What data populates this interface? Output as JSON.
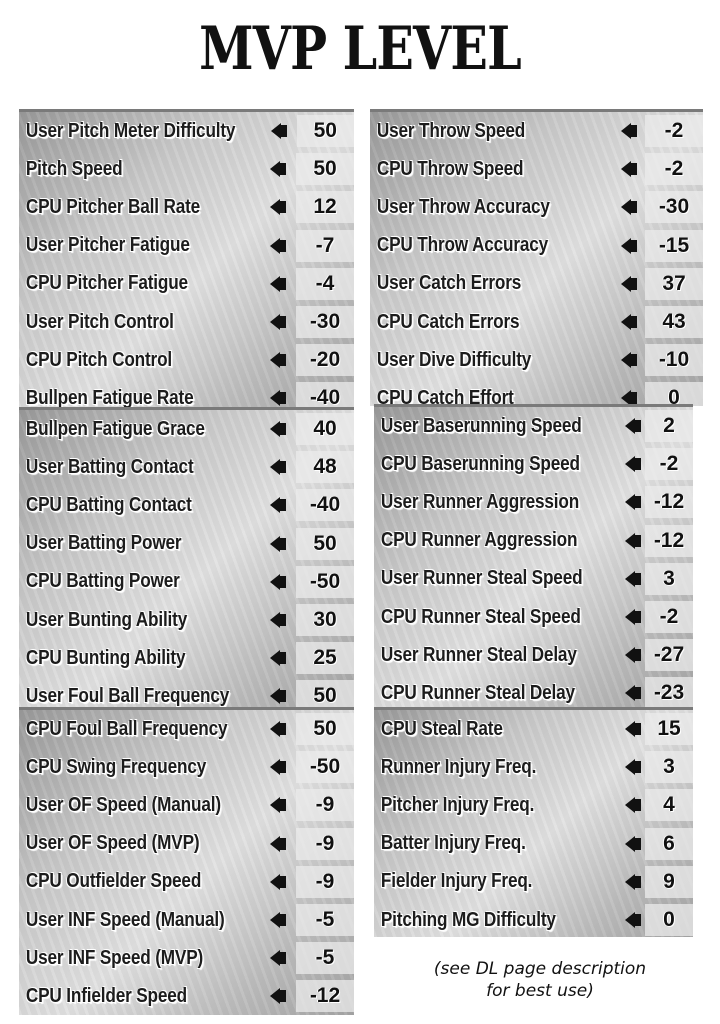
{
  "title": "MVP LEVEL",
  "note": [
    "(see DL page description",
    "for best use)"
  ],
  "panels": [
    {
      "rows": [
        {
          "label": "User Pitch Meter Difficulty",
          "value": "50"
        },
        {
          "label": "Pitch Speed",
          "value": "50"
        },
        {
          "label": "CPU Pitcher Ball Rate",
          "value": "12"
        },
        {
          "label": "User Pitcher Fatigue",
          "value": "-7"
        },
        {
          "label": "CPU Pitcher Fatigue",
          "value": "-4"
        },
        {
          "label": "User Pitch Control",
          "value": "-30"
        },
        {
          "label": "CPU Pitch Control",
          "value": "-20"
        },
        {
          "label": "Bullpen Fatigue Rate",
          "value": "-40"
        }
      ]
    },
    {
      "rows": [
        {
          "label": "Bullpen Fatigue Grace",
          "value": "40"
        },
        {
          "label": "User Batting Contact",
          "value": "48"
        },
        {
          "label": "CPU Batting Contact",
          "value": "-40"
        },
        {
          "label": "User Batting Power",
          "value": "50"
        },
        {
          "label": "CPU Batting Power",
          "value": "-50"
        },
        {
          "label": "User Bunting Ability",
          "value": "30"
        },
        {
          "label": "CPU Bunting Ability",
          "value": "25"
        },
        {
          "label": "User Foul Ball Frequency",
          "value": "50"
        }
      ]
    },
    {
      "rows": [
        {
          "label": "CPU Foul Ball Frequency",
          "value": "50"
        },
        {
          "label": "CPU Swing Frequency",
          "value": "-50"
        },
        {
          "label": "User OF Speed (Manual)",
          "value": "-9"
        },
        {
          "label": "User OF Speed (MVP)",
          "value": "-9"
        },
        {
          "label": "CPU Outfielder Speed",
          "value": "-9"
        },
        {
          "label": "User INF Speed (Manual)",
          "value": "-5"
        },
        {
          "label": "User INF Speed (MVP)",
          "value": "-5"
        },
        {
          "label": "CPU Infielder Speed",
          "value": "-12"
        }
      ]
    },
    {
      "rows": [
        {
          "label": "User Throw Speed",
          "value": "-2"
        },
        {
          "label": "CPU Throw Speed",
          "value": "-2"
        },
        {
          "label": "User Throw Accuracy",
          "value": "-30"
        },
        {
          "label": "CPU Throw Accuracy",
          "value": "-15"
        },
        {
          "label": "User Catch Errors",
          "value": "37"
        },
        {
          "label": "CPU Catch Errors",
          "value": "43"
        },
        {
          "label": "User Dive Difficulty",
          "value": "-10"
        },
        {
          "label": "CPU Catch Effort",
          "value": "0"
        }
      ]
    },
    {
      "rows": [
        {
          "label": "User Baserunning Speed",
          "value": "2"
        },
        {
          "label": "CPU Baserunning Speed",
          "value": "-2"
        },
        {
          "label": "User Runner Aggression",
          "value": "-12"
        },
        {
          "label": "CPU Runner Aggression",
          "value": "-12"
        },
        {
          "label": "User Runner Steal Speed",
          "value": "3"
        },
        {
          "label": "CPU Runner Steal Speed",
          "value": "-2"
        },
        {
          "label": "User Runner Steal Delay",
          "value": "-27"
        },
        {
          "label": "CPU Runner Steal Delay",
          "value": "-23"
        }
      ]
    },
    {
      "rows": [
        {
          "label": "CPU Steal Rate",
          "value": "15"
        },
        {
          "label": "Runner Injury Freq.",
          "value": "3"
        },
        {
          "label": "Pitcher Injury Freq.",
          "value": "4"
        },
        {
          "label": "Batter Injury Freq.",
          "value": "6"
        },
        {
          "label": "Fielder Injury Freq.",
          "value": "9"
        },
        {
          "label": "Pitching MG Difficulty",
          "value": "0"
        }
      ]
    }
  ]
}
